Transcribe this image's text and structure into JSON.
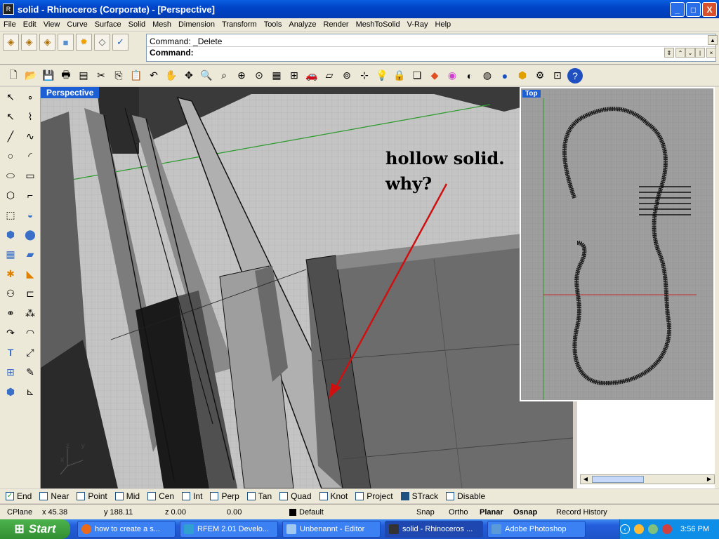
{
  "window": {
    "title": "solid - Rhinoceros (Corporate) - [Perspective]",
    "controls": {
      "minimize": "_",
      "maximize": "□",
      "close": "X"
    }
  },
  "menu": [
    "File",
    "Edit",
    "View",
    "Curve",
    "Surface",
    "Solid",
    "Mesh",
    "Dimension",
    "Transform",
    "Tools",
    "Analyze",
    "Render",
    "MeshToSolid",
    "V-Ray",
    "Help"
  ],
  "command": {
    "line1": "Command: _Delete",
    "line2": "Command:"
  },
  "viewports": {
    "main": {
      "label": "Perspective"
    },
    "top": {
      "label": "Top"
    }
  },
  "annotation": {
    "line1": "hollow solid.",
    "line2": "why?"
  },
  "axis_labels": {
    "z": "z",
    "y": "y",
    "x": "x"
  },
  "osnaps": [
    {
      "label": "End",
      "checked": true
    },
    {
      "label": "Near",
      "checked": false
    },
    {
      "label": "Point",
      "checked": false
    },
    {
      "label": "Mid",
      "checked": false
    },
    {
      "label": "Cen",
      "checked": false
    },
    {
      "label": "Int",
      "checked": false
    },
    {
      "label": "Perp",
      "checked": false
    },
    {
      "label": "Tan",
      "checked": false
    },
    {
      "label": "Quad",
      "checked": false
    },
    {
      "label": "Knot",
      "checked": false
    },
    {
      "label": "Project",
      "checked": false
    },
    {
      "label": "STrack",
      "checked": true
    },
    {
      "label": "Disable",
      "checked": false
    }
  ],
  "status": {
    "cplane": "CPlane",
    "x": "x 45.38",
    "y": "y 188.11",
    "z": "z 0.00",
    "dist": "0.00",
    "layer": "Default",
    "snap": "Snap",
    "ortho": "Ortho",
    "planar": "Planar",
    "osnap": "Osnap",
    "history": "Record History"
  },
  "taskbar": {
    "start": "Start",
    "items": [
      "how to create a s...",
      "RFEM 2.01 Develo...",
      "Unbenannt - Editor",
      "solid - Rhinoceros ...",
      "Adobe Photoshop"
    ],
    "active_index": 3,
    "clock": "3:56 PM"
  },
  "colors": {
    "title_blue": "#0044c8",
    "annotation_arrow": "#d01010",
    "grid_x": "#c03030",
    "grid_y": "#30a030"
  }
}
